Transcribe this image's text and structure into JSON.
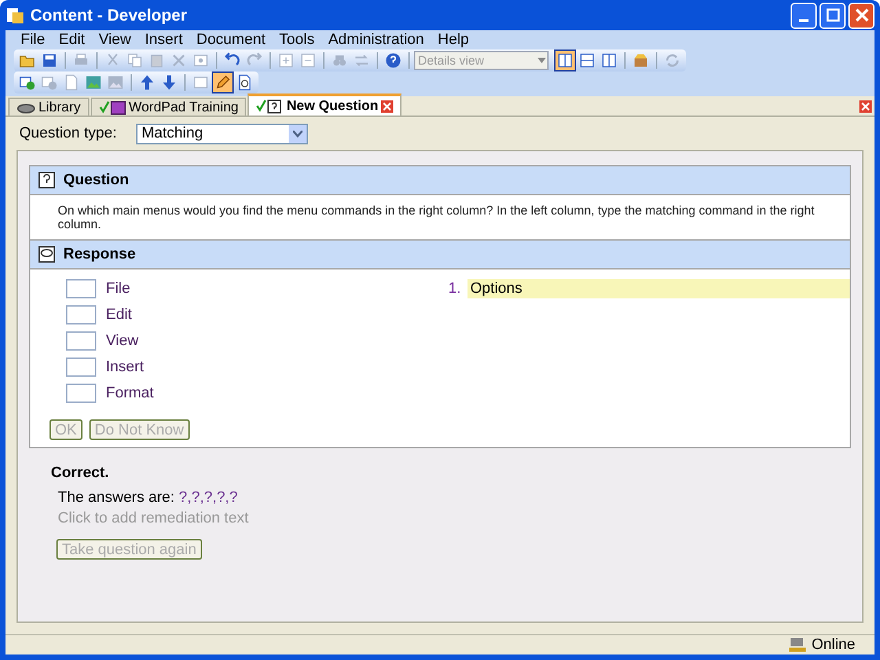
{
  "window": {
    "title": "Content - Developer"
  },
  "menu": [
    "File",
    "Edit",
    "View",
    "Insert",
    "Document",
    "Tools",
    "Administration",
    "Help"
  ],
  "toolbar_1": [
    {
      "disabled": false
    },
    {
      "disabled": false
    },
    {
      "disabled": true
    },
    {
      "disabled": true
    },
    {
      "disabled": true
    },
    {
      "disabled": true
    },
    {
      "disabled": true
    },
    {
      "disabled": true
    },
    {
      "disabled": false
    },
    {
      "disabled": true
    },
    {
      "disabled": true
    },
    {
      "disabled": true
    },
    {
      "disabled": true
    },
    {
      "disabled": true
    },
    {
      "disabled": false
    }
  ],
  "view_dropdown": {
    "value": "Details view",
    "disabled": true
  },
  "view_buttons": [
    {
      "selected": true
    },
    {
      "selected": false
    },
    {
      "selected": false
    }
  ],
  "toolbar_1_extra": [
    {
      "disabled": false
    },
    {
      "disabled": true
    }
  ],
  "toolbar_2": [
    {
      "disabled": false,
      "selected": false
    },
    {
      "disabled": true,
      "selected": false
    },
    {
      "disabled": true,
      "selected": false
    },
    {
      "disabled": false,
      "selected": false
    },
    {
      "disabled": true,
      "selected": false
    },
    {
      "disabled": false,
      "selected": false
    },
    {
      "disabled": false,
      "selected": false
    },
    {
      "disabled": true,
      "selected": false
    },
    {
      "disabled": false,
      "selected": true
    },
    {
      "disabled": false,
      "selected": false
    }
  ],
  "tabs": [
    {
      "label": "Library",
      "kind": "library",
      "selected": false
    },
    {
      "label": "WordPad Training",
      "kind": "course",
      "selected": false
    },
    {
      "label": "New Question",
      "kind": "question",
      "selected": true
    }
  ],
  "question_type": {
    "label": "Question type:",
    "value": "Matching"
  },
  "question": {
    "heading": "Question",
    "text": "On which main menus would you find the menu commands in the right column? In the left column, type the matching command in the right column."
  },
  "response": {
    "heading": "Response",
    "left_items": [
      {
        "label": "File"
      },
      {
        "label": "Edit"
      },
      {
        "label": "View"
      },
      {
        "label": "Insert"
      },
      {
        "label": "Format"
      }
    ],
    "right_items": [
      {
        "number": "1.",
        "text": "Options",
        "selected": true
      }
    ],
    "buttons": [
      {
        "label": "OK",
        "disabled": true
      },
      {
        "label": "Do Not Know",
        "disabled": true
      }
    ]
  },
  "feedback": {
    "title": "Correct.",
    "answers_label": "The answers are:",
    "answers": "?,?,?,?,?",
    "remediation_placeholder": "Click to add remediation text",
    "button": {
      "label": "Take question again",
      "disabled": true
    }
  },
  "status_bar": {
    "status": "Online"
  }
}
